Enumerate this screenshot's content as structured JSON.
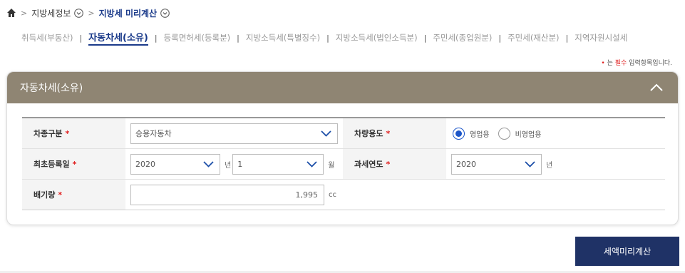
{
  "breadcrumb": {
    "home_icon": "home-icon",
    "items": [
      {
        "label": "지방세정보"
      },
      {
        "label": "지방세 미리계산"
      }
    ]
  },
  "tabs": [
    {
      "label": "취득세(부동산)",
      "active": false
    },
    {
      "label": "자동차세(소유)",
      "active": true
    },
    {
      "label": "등록면허세(등록분)",
      "active": false
    },
    {
      "label": "지방소득세(특별징수)",
      "active": false
    },
    {
      "label": "지방소득세(법인소득분)",
      "active": false
    },
    {
      "label": "주민세(종업원분)",
      "active": false
    },
    {
      "label": "주민세(재산분)",
      "active": false
    },
    {
      "label": "지역자원시설세",
      "active": false
    }
  ],
  "tab_separator": "|",
  "note": {
    "bullet": "•",
    "prefix": " 는 ",
    "required": "필수",
    "suffix": " 입력항목입니다."
  },
  "panel": {
    "title": "자동차세(소유)",
    "collapse_icon": "chevron-up-icon"
  },
  "form": {
    "required_mark": "*",
    "vehicle_type": {
      "label": "차종구분",
      "value": "승용자동차"
    },
    "vehicle_use": {
      "label": "차량용도",
      "options": [
        {
          "label": "영업용",
          "checked": true
        },
        {
          "label": "비영업용",
          "checked": false
        }
      ]
    },
    "first_registration": {
      "label": "최초등록일",
      "year": "2020",
      "year_unit": "년",
      "month": "1",
      "month_unit": "월"
    },
    "tax_year": {
      "label": "과세연도",
      "value": "2020",
      "unit": "년"
    },
    "displacement": {
      "label": "배기량",
      "value": "1,995",
      "unit": "cc"
    }
  },
  "calc_button": {
    "label": "세액미리계산"
  },
  "colors": {
    "header": "#8f8573",
    "accent": "#1a3a8a",
    "button": "#1f3266",
    "required": "#e02020",
    "radio": "#1c56c9"
  }
}
